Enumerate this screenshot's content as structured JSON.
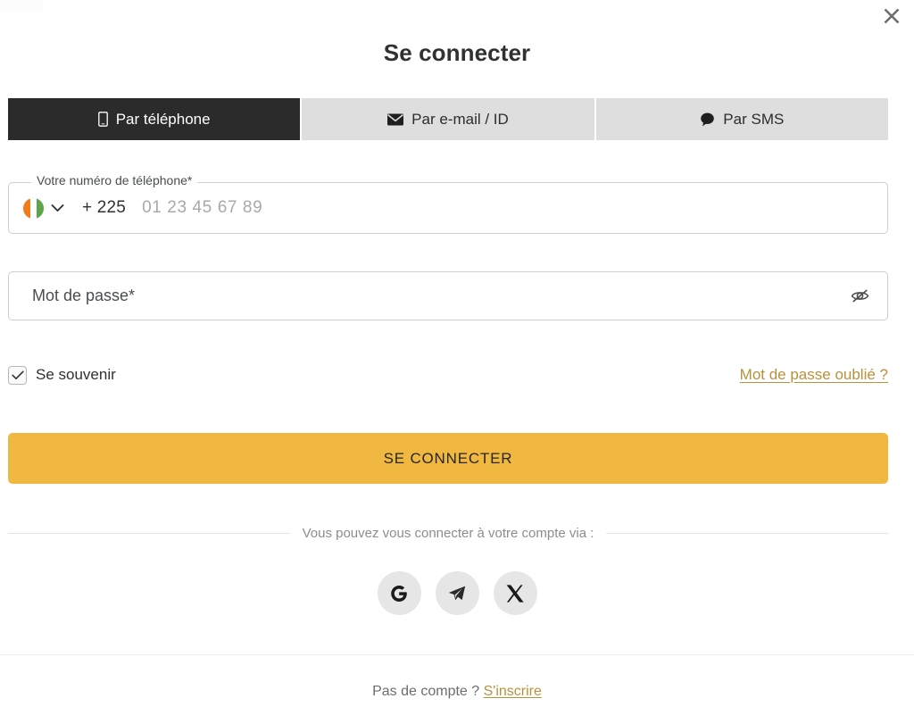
{
  "modal": {
    "title": "Se connecter",
    "close_label": "×",
    "close_icon": "close-icon"
  },
  "tabs": [
    {
      "label": "Par téléphone",
      "icon": "mobile-phone-icon",
      "active": true
    },
    {
      "label": "Par e-mail / ID",
      "icon": "envelope-icon",
      "active": false
    },
    {
      "label": "Par SMS",
      "icon": "speech-bubble-icon",
      "active": false
    }
  ],
  "phone_field": {
    "legend": "Votre numéro de téléphone*",
    "country": "Côte d'Ivoire",
    "flag_icon": "ci-flag-icon",
    "flag_colors": [
      "#F07D1A",
      "#FFFFFF",
      "#5CA54A"
    ],
    "caret_icon": "chevron-down-icon",
    "dial_code": "+ 225",
    "value": "",
    "placeholder": "01 23 45 67 89"
  },
  "password_field": {
    "value": "",
    "placeholder": "Mot de passe*",
    "toggle_icon": "eye-slash-icon"
  },
  "remember": {
    "label": "Se souvenir",
    "checked": true,
    "check_icon": "checkmark-icon"
  },
  "forgot_password": {
    "label": "Mot de passe oublié ?"
  },
  "submit": {
    "label": "SE CONNECTER",
    "color": "#F0B840"
  },
  "divider": {
    "text": "Vous pouvez vous connecter à votre compte via :"
  },
  "socials": [
    {
      "name": "google",
      "icon": "google-icon",
      "glyph": "G"
    },
    {
      "name": "telegram",
      "icon": "telegram-icon",
      "glyph": "➤"
    },
    {
      "name": "x-twitter",
      "icon": "x-icon",
      "glyph": "𝕏"
    }
  ],
  "footer": {
    "text": "Pas de compte ?",
    "link": "S'inscrire"
  },
  "colors": {
    "accent": "#F0B840",
    "link": "#B9913D",
    "tab_active_bg": "#2B2B2B",
    "tab_inactive_bg": "#DEDEDE"
  }
}
